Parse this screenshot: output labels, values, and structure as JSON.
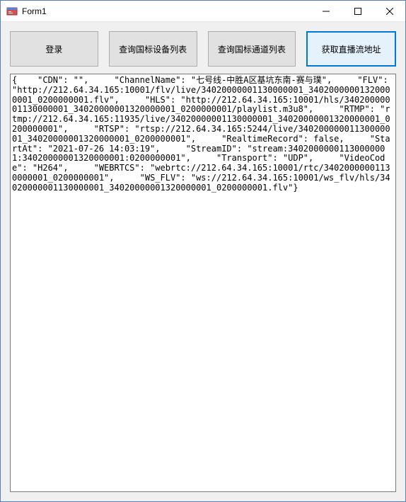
{
  "window": {
    "title": "Form1"
  },
  "buttons": {
    "login": "登录",
    "queryDevices": "查询国标设备列表",
    "queryChannels": "查询国标通道列表",
    "getStream": "获取直播流地址"
  },
  "output": "{    \"CDN\": \"\",     \"ChannelName\": \"七号线-中胜A区基坑东南-赛与璞\",     \"FLV\": \"http://212.64.34.165:10001/flv/live/34020000001130000001_34020000001320000001_0200000001.flv\",     \"HLS\": \"http://212.64.34.165:10001/hls/34020000001130000001_34020000001320000001_0200000001/playlist.m3u8\",     \"RTMP\": \"rtmp://212.64.34.165:11935/live/34020000001130000001_34020000001320000001_0200000001\",     \"RTSP\": \"rtsp://212.64.34.165:5244/live/34020000001130000001_34020000001320000001_0200000001\",     \"RealtimeRecord\": false,     \"StartAt\": \"2021-07-26 14:03:19\",     \"StreamID\": \"stream:34020000001130000001:34020000001320000001:0200000001\",     \"Transport\": \"UDP\",     \"VideoCode\": \"H264\",     \"WEBRTCS\": \"webrtc://212.64.34.165:10001/rtc/34020000001130000001_0200000001\",     \"WS_FLV\": \"ws://212.64.34.165:10001/ws_flv/hls/34020000001130000001_34020000001320000001_0200000001.flv\"}"
}
